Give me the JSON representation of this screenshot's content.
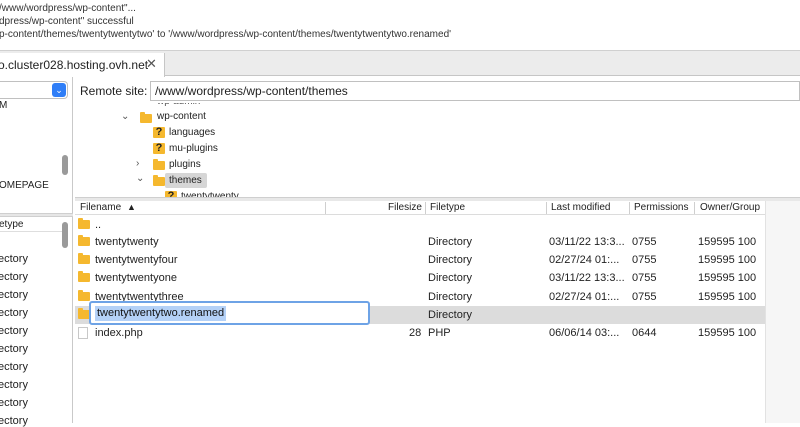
{
  "message_log": {
    "lines": [
      "/www/wordpress/wp-content\"...",
      "dpress/wp-content\" successful",
      "p-content/themes/twentytwentytwo' to '/www/wordpress/wp-content/themes/twentytwentytwo.renamed'"
    ]
  },
  "tab": {
    "label": "o.cluster028.hosting.ovh.net",
    "close_glyph": "✕"
  },
  "local": {
    "dropdown_glyph": "⌄",
    "tree_items": [
      "M",
      "OMEPAGE"
    ],
    "list_header": "etype",
    "rows": [
      "ectory",
      "ectory",
      "ectory",
      "ectory",
      "ectory",
      "ectory",
      "ectory",
      "ectory",
      "ectory",
      "ectory"
    ]
  },
  "remote": {
    "label": "Remote site:",
    "path": "/www/wordpress/wp-content/themes"
  },
  "tree": {
    "partial_top": "wp-admin",
    "nodes": [
      {
        "label": "wp-content",
        "icon": "folder-icon",
        "chevron": "⌄"
      },
      {
        "label": "languages",
        "icon": "unknown-folder-icon"
      },
      {
        "label": "mu-plugins",
        "icon": "unknown-folder-icon"
      },
      {
        "label": "plugins",
        "icon": "folder-icon",
        "chevron": "›"
      },
      {
        "label": "themes",
        "icon": "folder-icon",
        "chevron": "⌄"
      },
      {
        "label": "twentytwenty",
        "icon": "unknown-folder-icon"
      }
    ]
  },
  "columns": {
    "filename": "Filename",
    "sort_glyph": "▲",
    "filesize": "Filesize",
    "filetype": "Filetype",
    "last_modified": "Last modified",
    "permissions": "Permissions",
    "owner_group": "Owner/Group"
  },
  "files": [
    {
      "name": "..",
      "size": "",
      "type": "",
      "modified": "",
      "perms": "",
      "owner": "",
      "icon": "folder-icon"
    },
    {
      "name": "twentytwenty",
      "size": "",
      "type": "Directory",
      "modified": "03/11/22 13:3...",
      "perms": "0755",
      "owner": "159595 100",
      "icon": "folder-icon"
    },
    {
      "name": "twentytwentyfour",
      "size": "",
      "type": "Directory",
      "modified": "02/27/24 01:...",
      "perms": "0755",
      "owner": "159595 100",
      "icon": "folder-icon"
    },
    {
      "name": "twentytwentyone",
      "size": "",
      "type": "Directory",
      "modified": "03/11/22 13:3...",
      "perms": "0755",
      "owner": "159595 100",
      "icon": "folder-icon"
    },
    {
      "name": "twentytwentythree",
      "size": "",
      "type": "Directory",
      "modified": "02/27/24 01:...",
      "perms": "0755",
      "owner": "159595 100",
      "icon": "folder-icon"
    },
    {
      "name": "twentytwentytwo.renamed",
      "size": "",
      "type": "Directory",
      "modified": "",
      "perms": "",
      "owner": "",
      "icon": "folder-icon"
    },
    {
      "name": "index.php",
      "size": "28",
      "type": "PHP",
      "modified": "06/06/14 03:...",
      "perms": "0644",
      "owner": "159595 100",
      "icon": "file-icon"
    }
  ],
  "colors": {
    "folder": "#f5b82e",
    "selection": "#b4d1f7",
    "focus_ring": "#6ea3e6",
    "dropdown_accent": "#2f7ef7"
  }
}
